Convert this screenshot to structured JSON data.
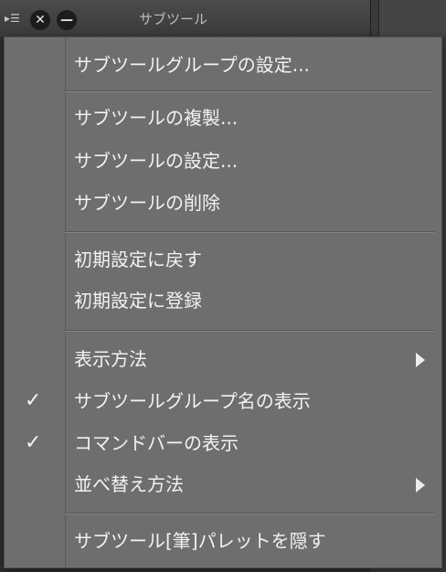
{
  "palette": {
    "title": "サブツール"
  },
  "menu": {
    "items": [
      {
        "label": "サブツールグループの設定..."
      },
      {
        "label": "サブツールの複製..."
      },
      {
        "label": "サブツールの設定..."
      },
      {
        "label": "サブツールの削除"
      },
      {
        "label": "初期設定に戻す"
      },
      {
        "label": "初期設定に登録"
      },
      {
        "label": "表示方法"
      },
      {
        "label": "サブツールグループ名の表示"
      },
      {
        "label": "コマンドバーの表示"
      },
      {
        "label": "並べ替え方法"
      },
      {
        "label": "サブツール[筆]パレットを隠す"
      }
    ],
    "check_glyph": "✓",
    "colors": {
      "background": "#6e6e6e",
      "text": "#f2f2f2"
    }
  },
  "icons": [
    "palette-menu-icon",
    "close-icon",
    "minimize-icon",
    "checkmark-icon",
    "submenu-arrow-icon"
  ]
}
